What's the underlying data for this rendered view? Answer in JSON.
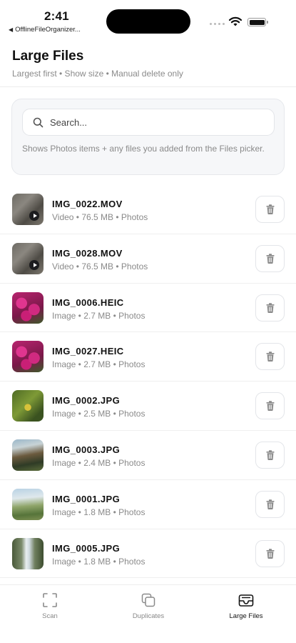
{
  "status_bar": {
    "time": "2:41",
    "back_app": "OfflineFileOrganizer..."
  },
  "header": {
    "title": "Large Files",
    "subtitle": "Largest first • Show size • Manual delete only"
  },
  "search": {
    "placeholder": "Search...",
    "hint": "Shows Photos items + any files you added from the Files picker."
  },
  "files": [
    {
      "name": "IMG_0022.MOV",
      "meta": "Video • 76.5 MB • Photos",
      "kind": "video"
    },
    {
      "name": "IMG_0028.MOV",
      "meta": "Video • 76.5 MB • Photos",
      "kind": "video"
    },
    {
      "name": "IMG_0006.HEIC",
      "meta": "Image • 2.7 MB • Photos",
      "kind": "image"
    },
    {
      "name": "IMG_0027.HEIC",
      "meta": "Image • 2.7 MB • Photos",
      "kind": "image"
    },
    {
      "name": "IMG_0002.JPG",
      "meta": "Image • 2.5 MB • Photos",
      "kind": "image"
    },
    {
      "name": "IMG_0003.JPG",
      "meta": "Image • 2.4 MB • Photos",
      "kind": "image"
    },
    {
      "name": "IMG_0001.JPG",
      "meta": "Image • 1.8 MB • Photos",
      "kind": "image"
    },
    {
      "name": "IMG_0005.JPG",
      "meta": "Image • 1.8 MB • Photos",
      "kind": "image"
    }
  ],
  "tabs": [
    {
      "label": "Scan",
      "icon": "scan-icon"
    },
    {
      "label": "Duplicates",
      "icon": "duplicates-icon"
    },
    {
      "label": "Large Files",
      "icon": "tray-icon",
      "active": true
    }
  ],
  "colors": {
    "accent": "#111111",
    "muted_text": "#8a8a8a",
    "card_bg": "#f6f7f9"
  }
}
